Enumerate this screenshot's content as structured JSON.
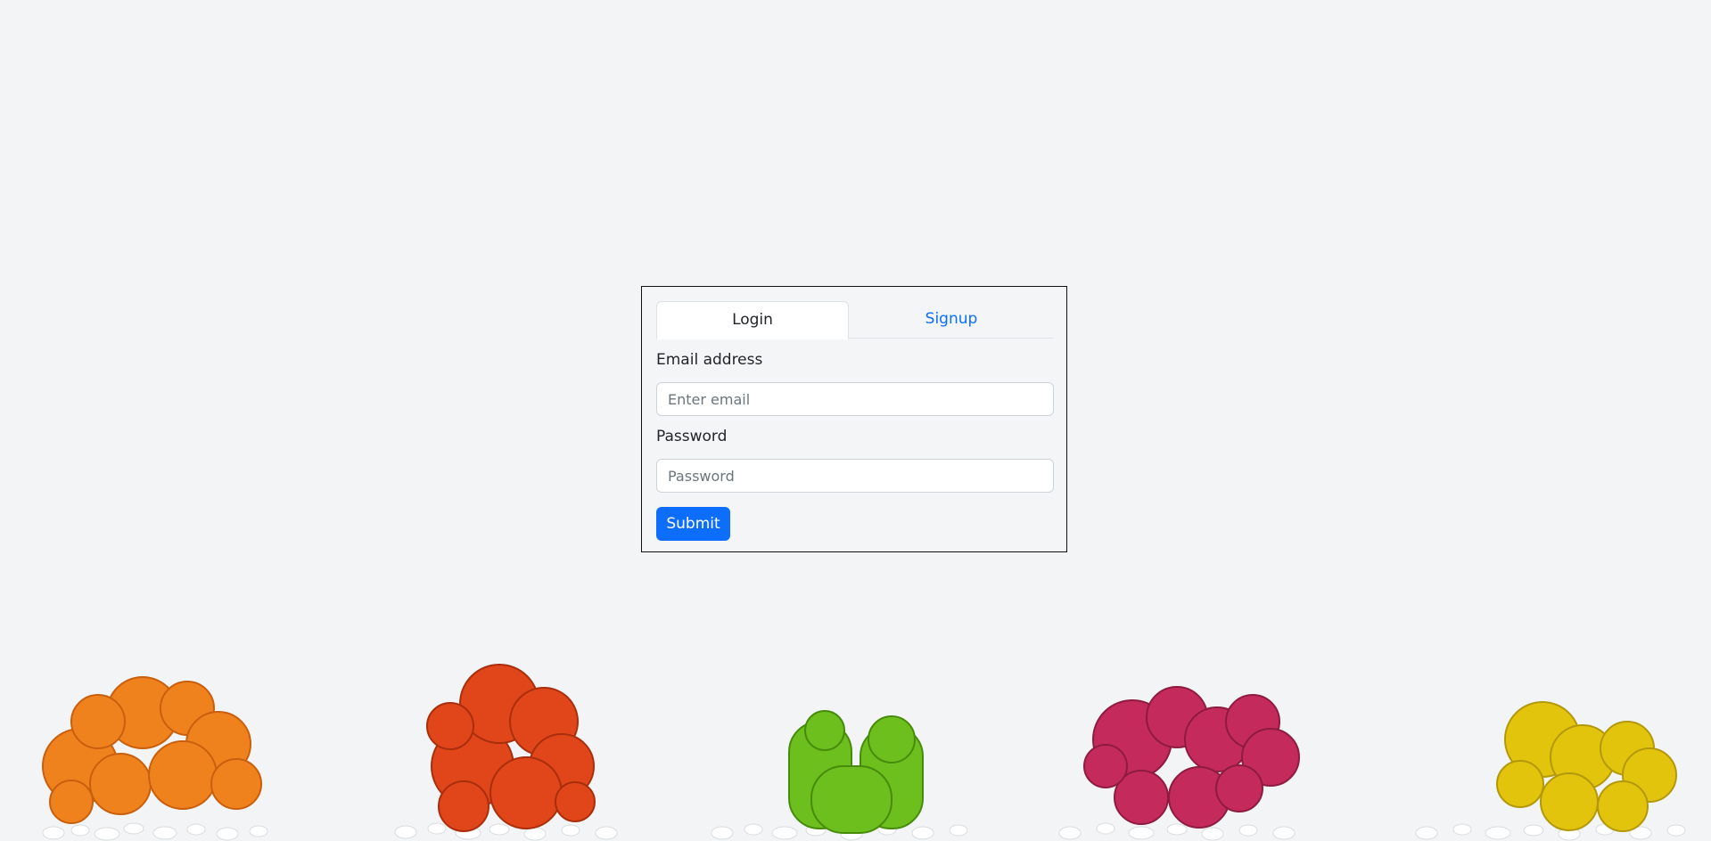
{
  "auth": {
    "tabs": [
      {
        "label": "Login",
        "active": true
      },
      {
        "label": "Signup",
        "active": false
      }
    ],
    "email": {
      "label": "Email address",
      "placeholder": "Enter email",
      "value": ""
    },
    "password": {
      "label": "Password",
      "placeholder": "Password",
      "value": ""
    },
    "submit_label": "Submit"
  },
  "background": {
    "description_icons": [
      "cactus-orange-icon",
      "cactus-red-icon",
      "cactus-green-icon",
      "cactus-pink-icon",
      "cactus-yellow-icon"
    ]
  },
  "colors": {
    "accent": "#0d6efd",
    "page_bg": "#f2f4f5",
    "cactus_orange": "#f0821e",
    "cactus_red": "#e0461a",
    "cactus_green": "#6cbf1c",
    "cactus_pink": "#c42a5c",
    "cactus_yellow": "#e3c40c"
  }
}
